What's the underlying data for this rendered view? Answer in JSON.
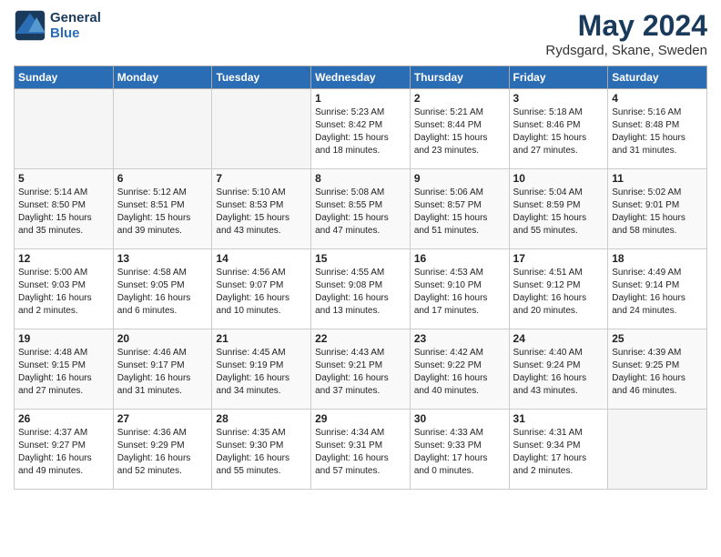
{
  "header": {
    "logo_line1": "General",
    "logo_line2": "Blue",
    "month_year": "May 2024",
    "location": "Rydsgard, Skane, Sweden"
  },
  "days_of_week": [
    "Sunday",
    "Monday",
    "Tuesday",
    "Wednesday",
    "Thursday",
    "Friday",
    "Saturday"
  ],
  "weeks": [
    [
      {
        "day": "",
        "sunrise": "",
        "sunset": "",
        "daylight": "",
        "empty": true
      },
      {
        "day": "",
        "sunrise": "",
        "sunset": "",
        "daylight": "",
        "empty": true
      },
      {
        "day": "",
        "sunrise": "",
        "sunset": "",
        "daylight": "",
        "empty": true
      },
      {
        "day": "1",
        "sunrise": "Sunrise: 5:23 AM",
        "sunset": "Sunset: 8:42 PM",
        "daylight": "Daylight: 15 hours and 18 minutes."
      },
      {
        "day": "2",
        "sunrise": "Sunrise: 5:21 AM",
        "sunset": "Sunset: 8:44 PM",
        "daylight": "Daylight: 15 hours and 23 minutes."
      },
      {
        "day": "3",
        "sunrise": "Sunrise: 5:18 AM",
        "sunset": "Sunset: 8:46 PM",
        "daylight": "Daylight: 15 hours and 27 minutes."
      },
      {
        "day": "4",
        "sunrise": "Sunrise: 5:16 AM",
        "sunset": "Sunset: 8:48 PM",
        "daylight": "Daylight: 15 hours and 31 minutes."
      }
    ],
    [
      {
        "day": "5",
        "sunrise": "Sunrise: 5:14 AM",
        "sunset": "Sunset: 8:50 PM",
        "daylight": "Daylight: 15 hours and 35 minutes."
      },
      {
        "day": "6",
        "sunrise": "Sunrise: 5:12 AM",
        "sunset": "Sunset: 8:51 PM",
        "daylight": "Daylight: 15 hours and 39 minutes."
      },
      {
        "day": "7",
        "sunrise": "Sunrise: 5:10 AM",
        "sunset": "Sunset: 8:53 PM",
        "daylight": "Daylight: 15 hours and 43 minutes."
      },
      {
        "day": "8",
        "sunrise": "Sunrise: 5:08 AM",
        "sunset": "Sunset: 8:55 PM",
        "daylight": "Daylight: 15 hours and 47 minutes."
      },
      {
        "day": "9",
        "sunrise": "Sunrise: 5:06 AM",
        "sunset": "Sunset: 8:57 PM",
        "daylight": "Daylight: 15 hours and 51 minutes."
      },
      {
        "day": "10",
        "sunrise": "Sunrise: 5:04 AM",
        "sunset": "Sunset: 8:59 PM",
        "daylight": "Daylight: 15 hours and 55 minutes."
      },
      {
        "day": "11",
        "sunrise": "Sunrise: 5:02 AM",
        "sunset": "Sunset: 9:01 PM",
        "daylight": "Daylight: 15 hours and 58 minutes."
      }
    ],
    [
      {
        "day": "12",
        "sunrise": "Sunrise: 5:00 AM",
        "sunset": "Sunset: 9:03 PM",
        "daylight": "Daylight: 16 hours and 2 minutes."
      },
      {
        "day": "13",
        "sunrise": "Sunrise: 4:58 AM",
        "sunset": "Sunset: 9:05 PM",
        "daylight": "Daylight: 16 hours and 6 minutes."
      },
      {
        "day": "14",
        "sunrise": "Sunrise: 4:56 AM",
        "sunset": "Sunset: 9:07 PM",
        "daylight": "Daylight: 16 hours and 10 minutes."
      },
      {
        "day": "15",
        "sunrise": "Sunrise: 4:55 AM",
        "sunset": "Sunset: 9:08 PM",
        "daylight": "Daylight: 16 hours and 13 minutes."
      },
      {
        "day": "16",
        "sunrise": "Sunrise: 4:53 AM",
        "sunset": "Sunset: 9:10 PM",
        "daylight": "Daylight: 16 hours and 17 minutes."
      },
      {
        "day": "17",
        "sunrise": "Sunrise: 4:51 AM",
        "sunset": "Sunset: 9:12 PM",
        "daylight": "Daylight: 16 hours and 20 minutes."
      },
      {
        "day": "18",
        "sunrise": "Sunrise: 4:49 AM",
        "sunset": "Sunset: 9:14 PM",
        "daylight": "Daylight: 16 hours and 24 minutes."
      }
    ],
    [
      {
        "day": "19",
        "sunrise": "Sunrise: 4:48 AM",
        "sunset": "Sunset: 9:15 PM",
        "daylight": "Daylight: 16 hours and 27 minutes."
      },
      {
        "day": "20",
        "sunrise": "Sunrise: 4:46 AM",
        "sunset": "Sunset: 9:17 PM",
        "daylight": "Daylight: 16 hours and 31 minutes."
      },
      {
        "day": "21",
        "sunrise": "Sunrise: 4:45 AM",
        "sunset": "Sunset: 9:19 PM",
        "daylight": "Daylight: 16 hours and 34 minutes."
      },
      {
        "day": "22",
        "sunrise": "Sunrise: 4:43 AM",
        "sunset": "Sunset: 9:21 PM",
        "daylight": "Daylight: 16 hours and 37 minutes."
      },
      {
        "day": "23",
        "sunrise": "Sunrise: 4:42 AM",
        "sunset": "Sunset: 9:22 PM",
        "daylight": "Daylight: 16 hours and 40 minutes."
      },
      {
        "day": "24",
        "sunrise": "Sunrise: 4:40 AM",
        "sunset": "Sunset: 9:24 PM",
        "daylight": "Daylight: 16 hours and 43 minutes."
      },
      {
        "day": "25",
        "sunrise": "Sunrise: 4:39 AM",
        "sunset": "Sunset: 9:25 PM",
        "daylight": "Daylight: 16 hours and 46 minutes."
      }
    ],
    [
      {
        "day": "26",
        "sunrise": "Sunrise: 4:37 AM",
        "sunset": "Sunset: 9:27 PM",
        "daylight": "Daylight: 16 hours and 49 minutes."
      },
      {
        "day": "27",
        "sunrise": "Sunrise: 4:36 AM",
        "sunset": "Sunset: 9:29 PM",
        "daylight": "Daylight: 16 hours and 52 minutes."
      },
      {
        "day": "28",
        "sunrise": "Sunrise: 4:35 AM",
        "sunset": "Sunset: 9:30 PM",
        "daylight": "Daylight: 16 hours and 55 minutes."
      },
      {
        "day": "29",
        "sunrise": "Sunrise: 4:34 AM",
        "sunset": "Sunset: 9:31 PM",
        "daylight": "Daylight: 16 hours and 57 minutes."
      },
      {
        "day": "30",
        "sunrise": "Sunrise: 4:33 AM",
        "sunset": "Sunset: 9:33 PM",
        "daylight": "Daylight: 17 hours and 0 minutes."
      },
      {
        "day": "31",
        "sunrise": "Sunrise: 4:31 AM",
        "sunset": "Sunset: 9:34 PM",
        "daylight": "Daylight: 17 hours and 2 minutes."
      },
      {
        "day": "",
        "sunrise": "",
        "sunset": "",
        "daylight": "",
        "empty": true
      }
    ]
  ]
}
